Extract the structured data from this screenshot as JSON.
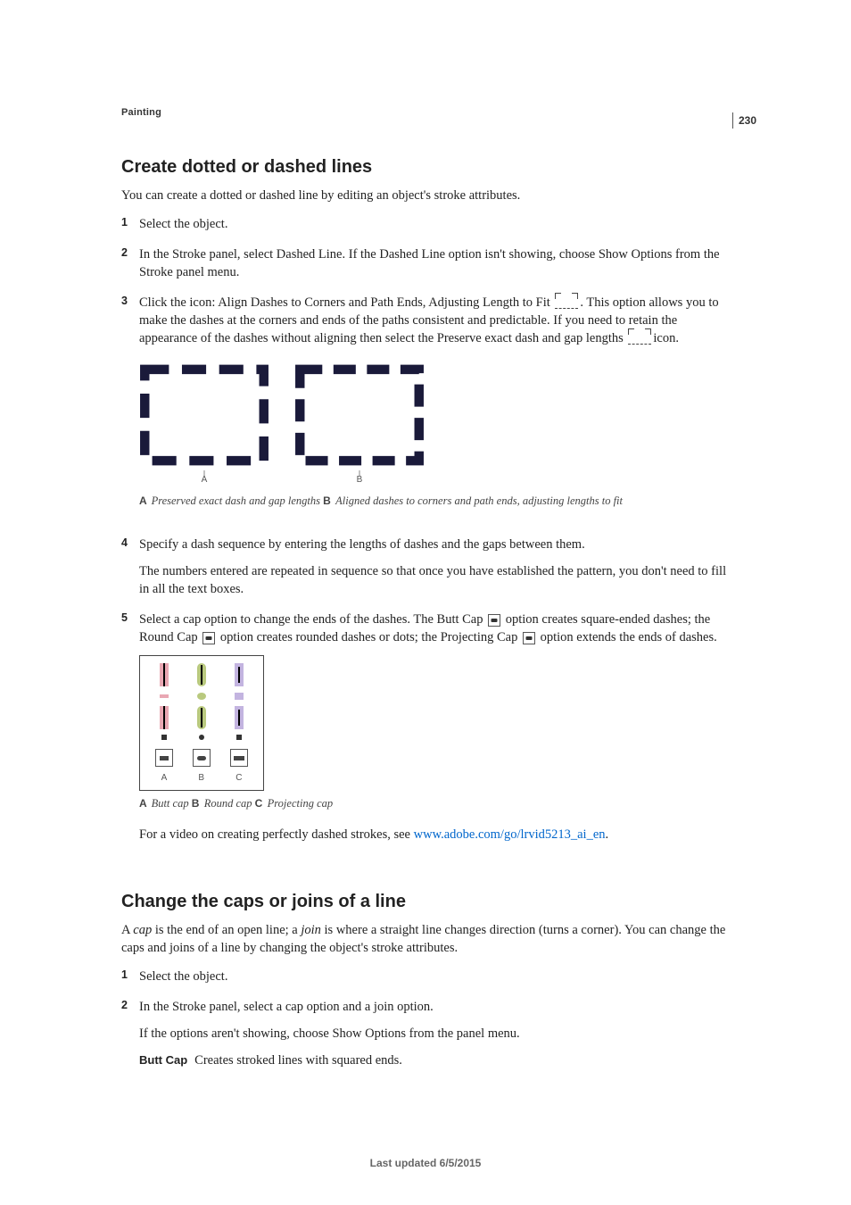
{
  "page_number": "230",
  "chapter": "Painting",
  "section1": {
    "heading": "Create dotted or dashed lines",
    "intro": "You can create a dotted or dashed line by editing an object's stroke attributes.",
    "steps": {
      "s1": "Select the object.",
      "s2": "In the Stroke panel, select Dashed Line. If the Dashed Line option isn't showing, choose Show Options from the Stroke panel menu.",
      "s3a": "Click the icon: Align Dashes to Corners and Path Ends, Adjusting Length to Fit ",
      "s3b": ". This option allows you to make the dashes at the corners and ends of the paths consistent and predictable. If you need to retain the appearance of the dashes without aligning then select the Preserve exact dash and gap lengths ",
      "s3c": "icon.",
      "s4": "Specify a dash sequence by entering the lengths of dashes and the gaps between them.",
      "s4b": "The numbers entered are repeated in sequence so that once you have established the pattern, you don't need to fill in all the text boxes.",
      "s5a": "Select a cap option to change the ends of the dashes. The Butt Cap ",
      "s5b": " option creates square-ended dashes; the Round Cap ",
      "s5c": " option creates rounded dashes or dots; the Projecting Cap ",
      "s5d": " option extends the ends of dashes.",
      "s5_video_pre": "For a video on creating perfectly dashed strokes, see ",
      "s5_video_link": "www.adobe.com/go/lrvid5213_ai_en",
      "s5_video_post": "."
    },
    "fig1": {
      "A_letter": "A",
      "B_letter": "B",
      "caption_A": "A ",
      "caption_A_text": "Preserved exact dash and gap lengths ",
      "caption_B": "B ",
      "caption_B_text": "Aligned dashes to corners and path ends, adjusting lengths to fit"
    },
    "fig2": {
      "A": "A",
      "B": "B",
      "C": "C",
      "caption_A": "A ",
      "caption_A_text": "Butt cap ",
      "caption_B": "B ",
      "caption_B_text": "Round cap ",
      "caption_C": "C ",
      "caption_C_text": "Projecting cap"
    }
  },
  "section2": {
    "heading": "Change the caps or joins of a line",
    "intro_a": "A ",
    "intro_cap": "cap",
    "intro_b": " is the end of an open line; a ",
    "intro_join": "join",
    "intro_c": " is where a straight line changes direction (turns a corner). You can change the caps and joins of a line by changing the object's stroke attributes.",
    "steps": {
      "s1": "Select the object.",
      "s2": "In the Stroke panel, select a cap option and a join option.",
      "s2b": "If the options aren't showing, choose Show Options from the panel menu.",
      "def_butt_term": "Butt Cap",
      "def_butt_text": "Creates stroked lines with squared ends."
    }
  },
  "footer": "Last updated 6/5/2015"
}
